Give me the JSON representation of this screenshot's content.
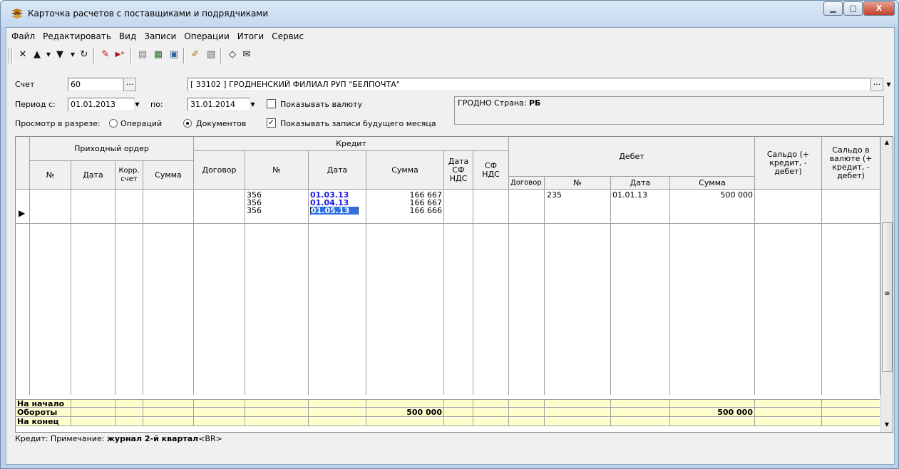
{
  "window": {
    "title": "Карточка расчетов с поставщиками и подрядчиками",
    "min_glyph": "▁",
    "max_glyph": "□",
    "close_glyph": "X"
  },
  "menu": [
    "Файл",
    "Редактировать",
    "Вид",
    "Записи",
    "Операции",
    "Итоги",
    "Сервис"
  ],
  "toolbar": {
    "icons": [
      "delete-icon",
      "move-up-icon",
      "move-down-icon",
      "refresh-icon",
      "edit-icon",
      "add-record-icon",
      "document-icon",
      "export-icon",
      "calendar-icon",
      "wizard-icon",
      "report-icon",
      "clear-icon",
      "mail-icon"
    ]
  },
  "form": {
    "account_label": "Счет",
    "account_value": "60",
    "partner_value": "[ 33102 ] ГРОДНЕНСКИЙ ФИЛИАЛ РУП \"БЕЛПОЧТА\"",
    "period_from_label": "Период с:",
    "period_from_value": "01.01.2013",
    "period_to_label": "по:",
    "period_to_value": "31.01.2014",
    "show_currency_label": "Показывать валюту",
    "show_currency_checked": false,
    "view_label": "Просмотр в разрезе:",
    "view_operations_label": "Операций",
    "view_documents_label": "Документов",
    "view_selected": "documents",
    "show_future_label": "Показывать записи будущего месяца",
    "show_future_checked": true,
    "ellipsis": "...",
    "info_city": "ГРОДНО",
    "info_country_label": "Страна:",
    "info_country_value": "РБ"
  },
  "grid": {
    "groups": {
      "receipt_order": "Приходный ордер",
      "credit": "Кредит",
      "debit": "Дебет"
    },
    "columns": {
      "ro_num": "№",
      "ro_date": "Дата",
      "ro_corr": "Корр. счет",
      "ro_sum": "Сумма",
      "cr_contract": "Договор",
      "cr_num": "№",
      "cr_date": "Дата",
      "cr_sum": "Сумма",
      "cr_vat_date": "Дата СФ НДС",
      "cr_vat": "СФ НДС",
      "db_contract": "Договор",
      "db_num": "№",
      "db_date": "Дата",
      "db_sum": "Сумма",
      "saldo": "Сальдо (+ кредит, - дебет)",
      "saldo_cur": "Сальдо в валюте (+ кредит, - дебет)"
    },
    "credit_lines": [
      {
        "num": "356",
        "date": "01.03.13",
        "sum": "166 667"
      },
      {
        "num": "356",
        "date": "01.04.13",
        "sum": "166 667"
      },
      {
        "num": "356",
        "date": "01.05.13",
        "sum": "166 666"
      }
    ],
    "debit_line": {
      "num": "235",
      "date": "01.01.13",
      "sum": "500 000"
    },
    "footer": {
      "start_label": "На начало",
      "turnover_label": "Обороты",
      "turnover_credit": "500 000",
      "turnover_debit": "500 000",
      "end_label": "На конец"
    }
  },
  "status": {
    "prefix": "Кредит: Примечание:",
    "note": "журнал 2-й квартал",
    "suffix": "<BR>"
  }
}
